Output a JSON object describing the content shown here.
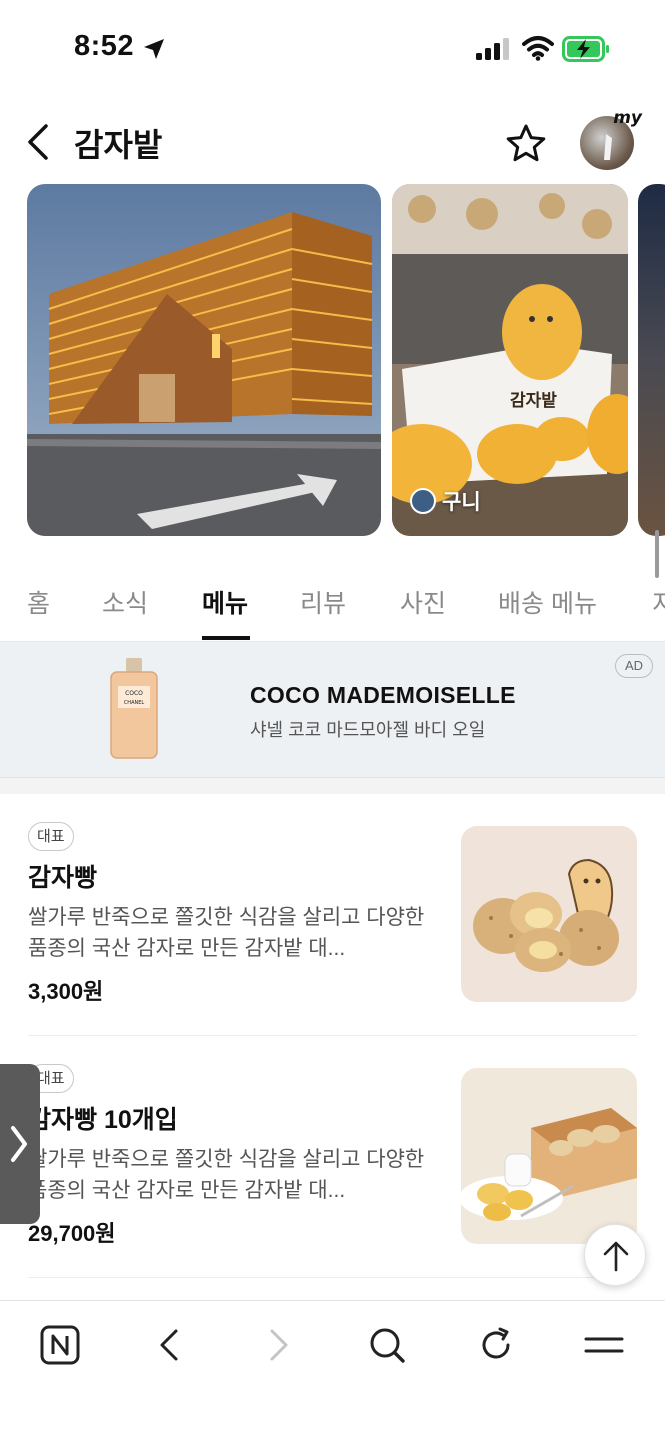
{
  "status_bar": {
    "time": "8:52"
  },
  "header": {
    "title": "감자밭",
    "avatar_badge": "my"
  },
  "photos": {
    "credit_name": "구니"
  },
  "tabs": [
    "홈",
    "소식",
    "메뉴",
    "리뷰",
    "사진",
    "배송 메뉴",
    "지"
  ],
  "active_tab": "메뉴",
  "ad": {
    "title": "COCO MADEMOISELLE",
    "subtitle": "샤넬 코코 마드모아젤 바디 오일",
    "badge": "AD",
    "bottle_text": [
      "COCO",
      "CHANEL"
    ]
  },
  "menu_items": [
    {
      "badge": "대표",
      "name": "감자빵",
      "description": "쌀가루 반죽으로 쫄깃한 식감을 살리고 다양한 품종의 국산 감자로 만든 감자밭 대...",
      "price": "3,300원"
    },
    {
      "badge": "대표",
      "name": "감자빵 10개입",
      "description": "쌀가루 반죽으로 쫄깃한 식감을 살리고 다양한 품종의 국산 감자로 만든 감자밭 대...",
      "price": "29,700원"
    }
  ],
  "colors": {
    "battery": "#34c759",
    "side_tab": "#5a5a5a",
    "ad_bg": "#eef1f4"
  }
}
